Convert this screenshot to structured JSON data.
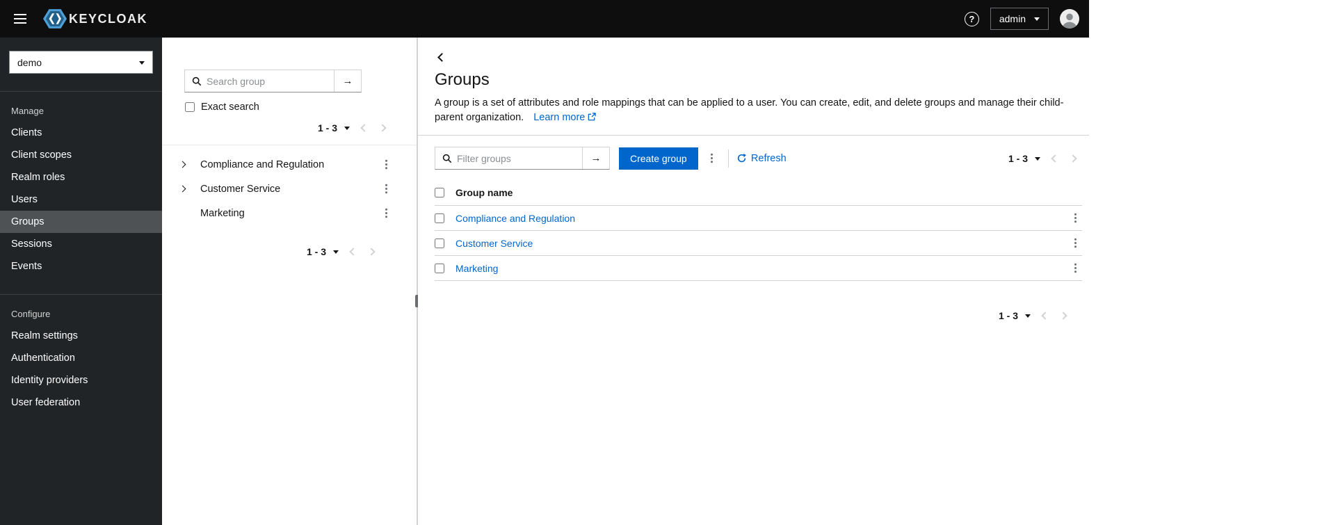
{
  "topbar": {
    "brand": "KEYCLOAK",
    "user": "admin"
  },
  "sidebar": {
    "realm": "demo",
    "sections": [
      {
        "label": "Manage",
        "items": [
          {
            "label": "Clients"
          },
          {
            "label": "Client scopes"
          },
          {
            "label": "Realm roles"
          },
          {
            "label": "Users"
          },
          {
            "label": "Groups",
            "active": true
          },
          {
            "label": "Sessions"
          },
          {
            "label": "Events"
          }
        ]
      },
      {
        "label": "Configure",
        "items": [
          {
            "label": "Realm settings"
          },
          {
            "label": "Authentication"
          },
          {
            "label": "Identity providers"
          },
          {
            "label": "User federation"
          }
        ]
      }
    ]
  },
  "tree_panel": {
    "search_placeholder": "Search group",
    "exact_search_label": "Exact search",
    "pagination_top": "1 - 3",
    "pagination_bottom": "1 - 3",
    "items": [
      {
        "label": "Compliance and Regulation",
        "expandable": true
      },
      {
        "label": "Customer Service",
        "expandable": true
      },
      {
        "label": "Marketing",
        "expandable": false
      }
    ]
  },
  "main": {
    "title": "Groups",
    "description": "A group is a set of attributes and role mappings that can be applied to a user. You can create, edit, and delete groups and manage their child-parent organization.",
    "learn_more_label": "Learn more",
    "toolbar": {
      "filter_placeholder": "Filter groups",
      "create_button_label": "Create group",
      "refresh_label": "Refresh",
      "pagination": "1 - 3"
    },
    "table": {
      "columns": [
        "Group name"
      ],
      "rows": [
        {
          "name": "Compliance and Regulation"
        },
        {
          "name": "Customer Service"
        },
        {
          "name": "Marketing"
        }
      ]
    },
    "pagination_bottom": "1 - 3"
  },
  "icons": {
    "search": "magnifier",
    "submit_arrow": "→",
    "kebab": "vertical-ellipsis",
    "help": "?",
    "external_link": "box-with-arrow",
    "refresh": "circular-arrow",
    "caret_down": "▾",
    "chevron": "angle"
  },
  "colors": {
    "accent_blue": "#0066cc",
    "masthead_bg": "#0e0e0e",
    "sidebar_bg": "#212427",
    "active_item_bg": "#4f5255",
    "logo_blue": "#4d9fd6"
  }
}
